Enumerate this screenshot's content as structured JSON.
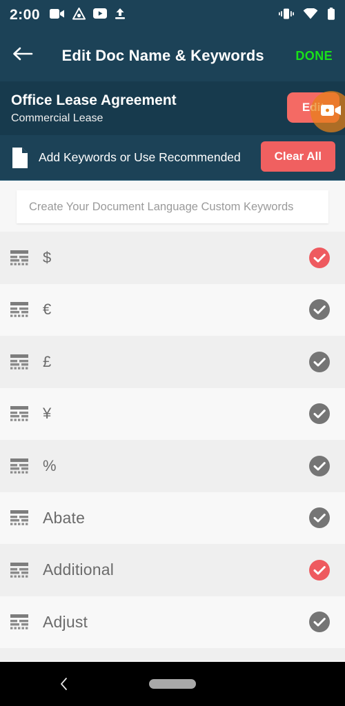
{
  "status_bar": {
    "time": "2:00",
    "left_icons": [
      "video-camera-icon",
      "drive-triangle-icon",
      "youtube-icon",
      "upload-icon"
    ],
    "right_icons": [
      "vibrate-icon",
      "wifi-icon",
      "battery-icon"
    ]
  },
  "title_bar": {
    "back_icon": "back-arrow-icon",
    "title": "Edit Doc Name & Keywords",
    "done_label": "DONE",
    "done_color": "#19e019"
  },
  "doc_header": {
    "title": "Office Lease Agreement",
    "subtitle": "Commercial Lease",
    "edit_label": "Edit",
    "edit_color": "#f46a64"
  },
  "floating_bubble": {
    "icon": "video-camera-icon",
    "color": "#e88118"
  },
  "keywords_bar": {
    "file_icon": "document-file-icon",
    "label": "Add Keywords or Use Recommended",
    "clear_label": "Clear All",
    "clear_color": "#f06060"
  },
  "custom_input": {
    "value": "",
    "placeholder": "Create Your Document Language Custom Keywords"
  },
  "colors": {
    "header_navy": "#1c4257",
    "doc_navy": "#173a4d",
    "selected_check": "#ee5a5f",
    "unselected_check": "#757575"
  },
  "keyword_rows": [
    {
      "icon": "text-lines-icon",
      "label": "$",
      "selected": true,
      "symbol": true
    },
    {
      "icon": "text-lines-icon",
      "label": "€",
      "selected": false,
      "symbol": true
    },
    {
      "icon": "text-lines-icon",
      "label": "£",
      "selected": false,
      "symbol": true
    },
    {
      "icon": "text-lines-icon",
      "label": "¥",
      "selected": false,
      "symbol": true
    },
    {
      "icon": "text-lines-icon",
      "label": "%",
      "selected": false,
      "symbol": true
    },
    {
      "icon": "text-lines-icon",
      "label": "Abate",
      "selected": false,
      "symbol": false
    },
    {
      "icon": "text-lines-icon",
      "label": "Additional",
      "selected": true,
      "symbol": false
    },
    {
      "icon": "text-lines-icon",
      "label": "Adjust",
      "selected": false,
      "symbol": false
    }
  ],
  "nav_bar": {
    "back_icon": "nav-back-chevron-icon",
    "home_icon": "nav-home-pill-icon"
  }
}
